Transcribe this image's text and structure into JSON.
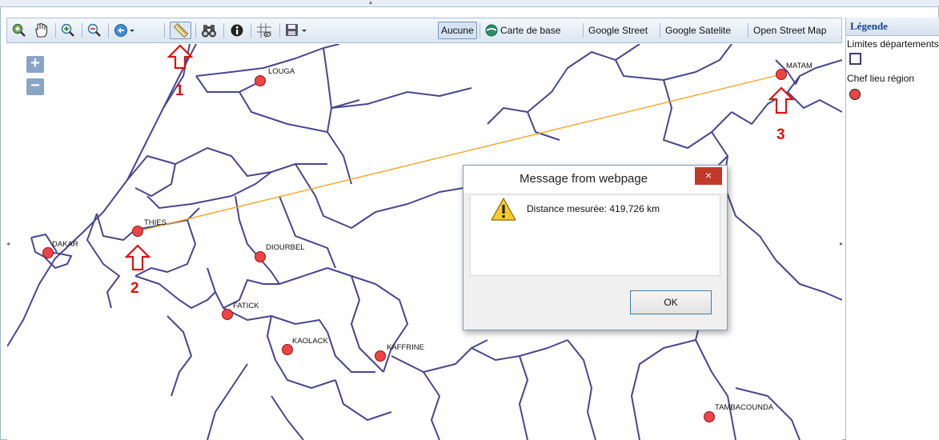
{
  "toolbar": {
    "tools": [
      {
        "name": "zoom-extent-icon",
        "label": ""
      },
      {
        "name": "pan-hand-icon",
        "label": ""
      },
      {
        "name": "zoom-in-icon",
        "label": ""
      },
      {
        "name": "zoom-out-icon",
        "label": ""
      },
      {
        "name": "history-icon",
        "label": ""
      },
      {
        "name": "measure-ruler-icon",
        "label": ""
      },
      {
        "name": "binoculars-icon",
        "label": ""
      },
      {
        "name": "info-icon",
        "label": ""
      },
      {
        "name": "grid-icon",
        "label": ""
      },
      {
        "name": "save-icon",
        "label": ""
      }
    ],
    "layers": {
      "aucune": "Aucune",
      "carte_de_base": "Carte de base",
      "google_street": "Google Street",
      "google_satelite": "Google Satelite",
      "open_street_map": "Open Street Map"
    }
  },
  "map": {
    "zoom_in": "+",
    "zoom_out": "−",
    "cities": {
      "louga": "LOUGA",
      "matam": "MATAM",
      "thies": "THIES",
      "dakar": "DAKAR",
      "diourbel": "DIOURBEL",
      "fatick": "FATICK",
      "kaolack": "KAOLACK",
      "kaffrine": "KAFFRINE",
      "tambacounda": "TAMBACOUNDA"
    },
    "annotations": {
      "a1": "1",
      "a2": "2",
      "a3": "3"
    },
    "colors": {
      "borders": "#4a4590",
      "city": "#ef4444",
      "measure_line": "#f5a623",
      "annotation": "#e01010"
    }
  },
  "legend": {
    "title": "Légende",
    "item1": "Limites départements",
    "item2": "Chef lieu région"
  },
  "dialog": {
    "title": "Message from webpage",
    "close": "×",
    "message": "Distance mesurée: 419,726 km",
    "ok": "OK"
  }
}
